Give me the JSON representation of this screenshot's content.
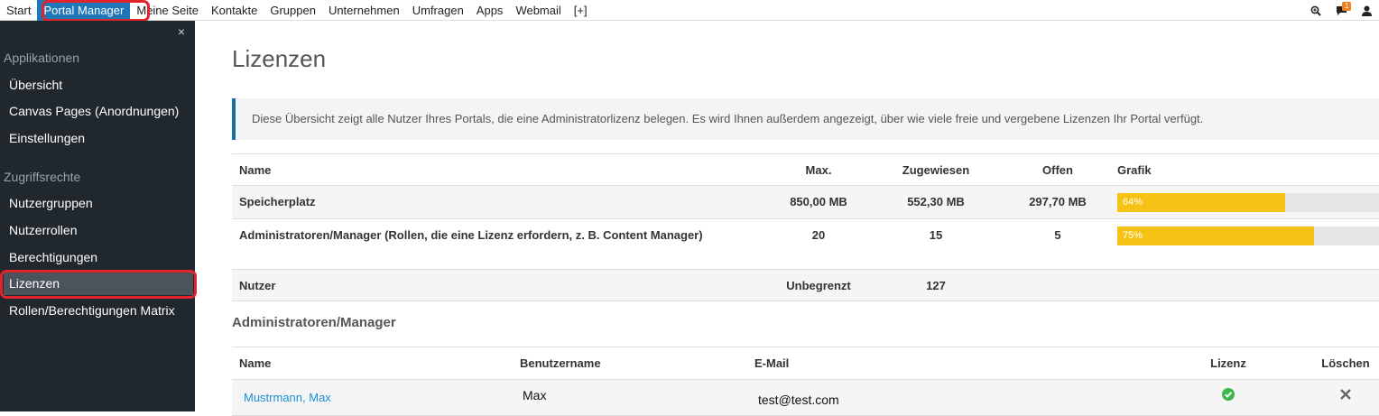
{
  "topnav": {
    "items": [
      "Start",
      "Portal Manager",
      "Meine Seite",
      "Kontakte",
      "Gruppen",
      "Unternehmen",
      "Umfragen",
      "Apps",
      "Webmail",
      "[+]"
    ],
    "notification_count": "1"
  },
  "sidebar": {
    "close": "×",
    "section_applications": "Applikationen",
    "section_access": "Zugriffsrechte",
    "links": [
      "Übersicht",
      "Canvas Pages (Anordnungen)",
      "Einstellungen",
      "Nutzergruppen",
      "Nutzerrollen",
      "Berechtigungen",
      "Lizenzen",
      "Rollen/Berechtigungen Matrix"
    ]
  },
  "page": {
    "title": "Lizenzen",
    "info": "Diese Übersicht zeigt alle Nutzer Ihres Portals, die eine Administratorlizenz belegen. Es wird Ihnen außerdem angezeigt, über wie viele freie und vergebene Lizenzen Ihr Portal verfügt."
  },
  "license_table": {
    "headers": [
      "Name",
      "Max.",
      "Zugewiesen",
      "Offen",
      "Grafik"
    ],
    "rows": [
      {
        "name": "Speicherplatz",
        "max": "850,00 MB",
        "assigned": "552,30 MB",
        "open": "297,70 MB",
        "bar_label": "64%",
        "bar_value": 0.64
      },
      {
        "name": "Administratoren/Manager  (Rollen, die eine Lizenz erfordern, z. B. Content Manager)",
        "max": "20",
        "assigned": "15",
        "open": "5",
        "bar_label": "75%",
        "bar_value": 0.75
      },
      {
        "name": "Nutzer",
        "max": "Unbegrenzt",
        "assigned": "127",
        "open": ""
      }
    ]
  },
  "admins": {
    "heading": "Administratoren/Manager",
    "headers": [
      "Name",
      "Benutzername",
      "E-Mail",
      "Lizenz",
      "Löschen"
    ],
    "rows": [
      {
        "name": "Mustrmann, Max",
        "username": "Max",
        "email": "test@test.com"
      }
    ]
  },
  "colors": {
    "accent": "#1d77b8",
    "sidebar": "#20272d",
    "bar": "#f7c216",
    "highlight": "#e0242a",
    "ok": "#3cb54a"
  }
}
